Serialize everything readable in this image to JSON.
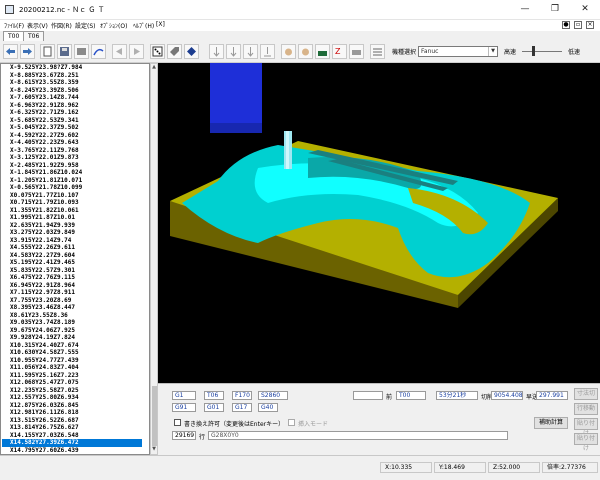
{
  "window": {
    "title": "20200212.nc - Ｎｃ Ｇ Ｔ",
    "minimize_glyph": "—",
    "maximize_glyph": "❐",
    "close_glyph": "✕"
  },
  "menu": {
    "items": [
      "ﾌｧｲﾙ(F)",
      "表示(V)",
      "作図(R)",
      "設定(S)",
      "ｵﾌﾟｼｮﾝ(O)",
      "ﾍﾙﾌﾟ(H)",
      "[X]"
    ]
  },
  "tabs": [
    "T00",
    "T06"
  ],
  "toolbar": {
    "model_select_label": "機種選択",
    "model_value": "Fanuc",
    "speed_high": "高速",
    "speed_low": "低速"
  },
  "nc_program": {
    "lines": [
      "X-9.525Y23.98?Z7.984",
      "X-8.885Y23.67Z8.251",
      "X-8.615Y23.55Z8.359",
      "X-8.245Y23.39Z8.506",
      "X-7.605Y23.14Z8.744",
      "X-6.963Y22.91Z8.962",
      "X-6.325Y22.71Z9.162",
      "X-5.685Y22.53Z9.341",
      "X-5.045Y22.37Z9.502",
      "X-4.592Y22.27Z9.602",
      "X-4.405Y22.23Z9.643",
      "X-3.765Y22.11Z9.768",
      "X-3.125Y22.01Z9.873",
      "X-2.485Y21.92Z9.958",
      "X-1.845Y21.86Z10.024",
      "X-1.205Y21.81Z10.071",
      "X-0.565Y21.78Z10.099",
      "X0.075Y21.77Z10.107",
      "X0.715Y21.79Z10.093",
      "X1.355Y21.82Z10.061",
      "X1.995Y21.87Z10.01",
      "X2.635Y21.94Z9.939",
      "X3.275Y22.03Z9.849",
      "X3.915Y22.14Z9.74",
      "X4.555Y22.26Z9.611",
      "X4.583Y22.27Z9.604",
      "X5.195Y22.41Z9.465",
      "X5.835Y22.57Z9.301",
      "X6.475Y22.76Z9.115",
      "X6.945Y22.91Z8.964",
      "X7.115Y22.97Z8.911",
      "X7.755Y23.20Z8.69",
      "X8.395Y23.46Z8.447",
      "X8.61Y23.55Z8.36",
      "X9.035Y23.74Z8.189",
      "X9.675Y24.06Z7.925",
      "X9.928Y24.19Z7.824",
      "X10.315Y24.40Z7.674",
      "X10.630Y24.58Z7.555",
      "X10.955Y24.77Z7.439",
      "X11.056Y24.83Z7.404",
      "X11.595Y25.16Z7.223",
      "X12.068Y25.47Z7.075",
      "X12.235Y25.58Z7.025",
      "X12.557Y25.80Z6.934",
      "X12.875Y26.03Z6.845",
      "X12.981Y26.11Z6.818",
      "X13.515Y26.52Z6.687",
      "X13.814Y26.75Z6.627",
      "X14.155Y27.03Z6.548",
      "X14.582Y27.39Z6.472",
      "X14.795Y27.60Z6.439"
    ],
    "selected_index": 50
  },
  "cutting_info": {
    "fields_row1": [
      "G1",
      "T06",
      "F170",
      "S2860"
    ],
    "fields_row2": [
      "G91",
      "G01",
      "G17",
      "G40"
    ],
    "prev_label": "前",
    "prev_tool": "T00",
    "time_value": "53分21秒",
    "cut_label": "切削",
    "cut_value": "9054.408",
    "feed_label": "早送",
    "feed_value": "297.991",
    "calc_button": "補助計算",
    "write_checkbox_label": "書き換え許可（変更後はEnterキー）",
    "insert_mode_label": "挿入モード",
    "line_number": "29169",
    "line_label": "行",
    "line_code": "G28X0Y0",
    "right_buttons": [
      "寸法切",
      "行移動",
      "貼り付け",
      "貼り付け"
    ]
  },
  "statusbar": {
    "x": "X:10.335",
    "y": "Y:18.469",
    "z": "Z:52.000",
    "scale": "倍率:2.77376"
  }
}
